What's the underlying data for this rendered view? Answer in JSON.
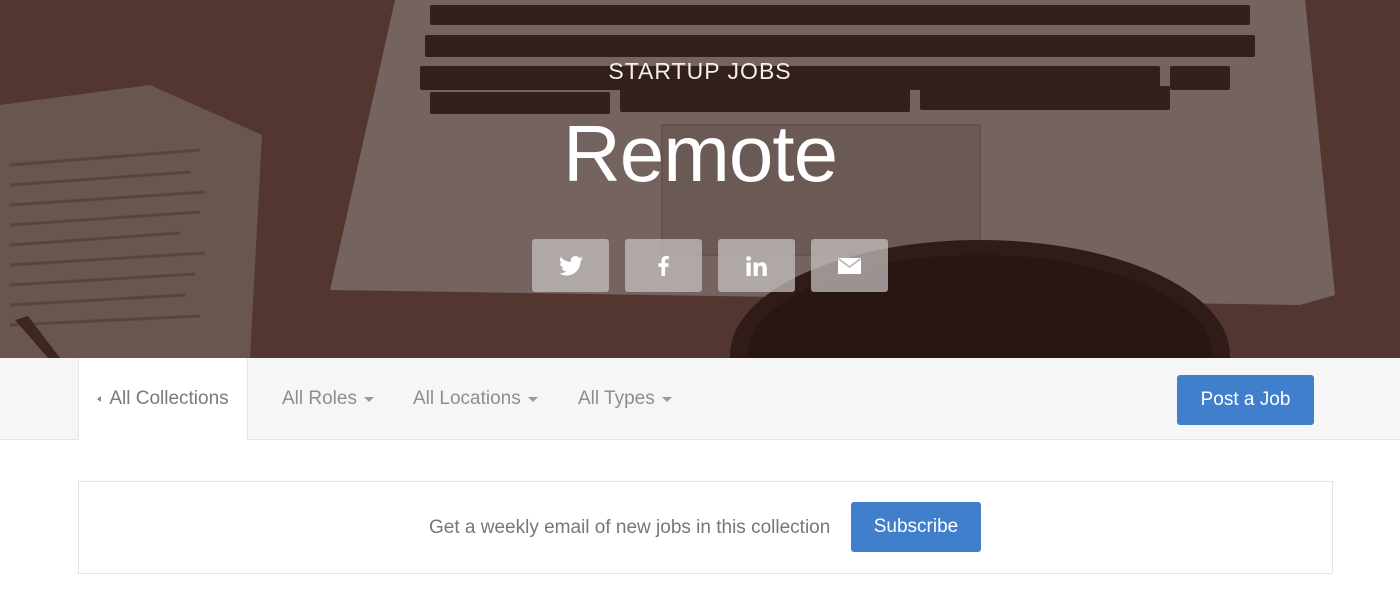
{
  "hero": {
    "eyebrow": "STARTUP JOBS",
    "title": "Remote",
    "share_buttons": [
      {
        "icon": "twitter-icon"
      },
      {
        "icon": "facebook-icon"
      },
      {
        "icon": "linkedin-icon"
      },
      {
        "icon": "email-icon"
      }
    ]
  },
  "nav": {
    "back_label": "All Collections",
    "filters": [
      {
        "label": "All Roles"
      },
      {
        "label": "All Locations"
      },
      {
        "label": "All Types"
      }
    ],
    "post_job_label": "Post a Job"
  },
  "subscribe": {
    "text": "Get a weekly email of new jobs in this collection",
    "button_label": "Subscribe"
  },
  "colors": {
    "accent_blue": "#3f7fcb",
    "hero_tint": "#4d3530"
  }
}
